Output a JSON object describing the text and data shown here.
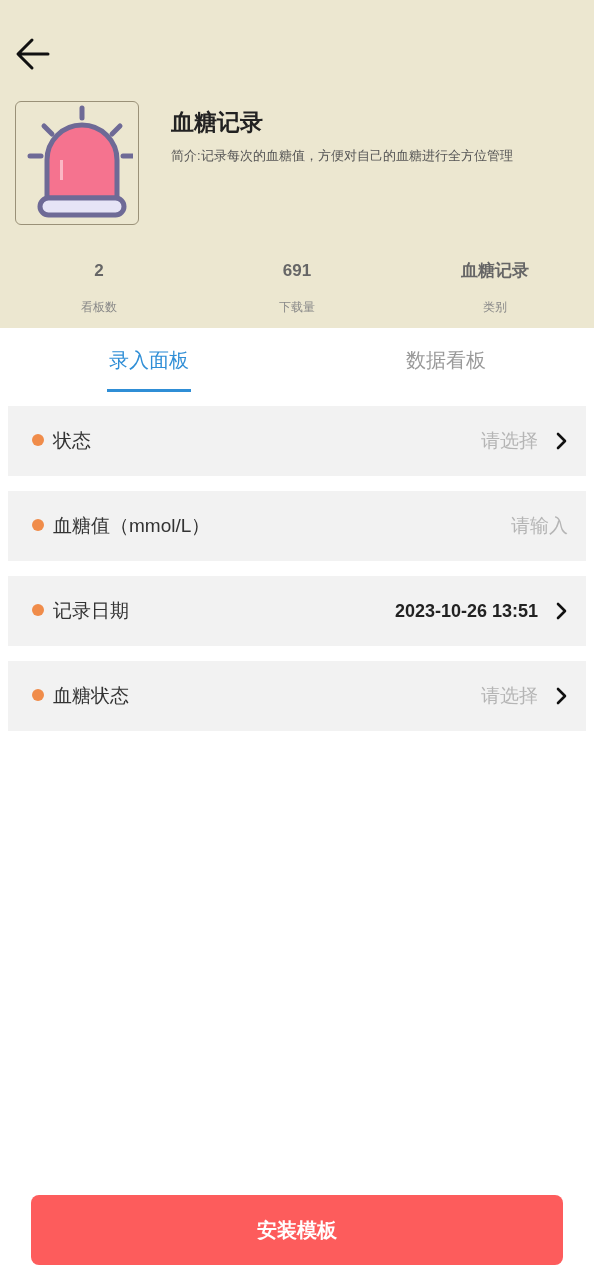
{
  "header": {
    "title": "血糖记录",
    "description": "简介:记录每次的血糖值，方便对自己的血糖进行全方位管理"
  },
  "stats": [
    {
      "value": "2",
      "label": "看板数"
    },
    {
      "value": "691",
      "label": "下载量"
    },
    {
      "value": "血糖记录",
      "label": "类别"
    }
  ],
  "tabs": [
    {
      "label": "录入面板",
      "selected": true
    },
    {
      "label": "数据看板",
      "selected": false
    }
  ],
  "fields": [
    {
      "kind": "select",
      "label": "状态",
      "required": true,
      "placeholder": "请选择"
    },
    {
      "kind": "input",
      "label": "血糖值（mmol/L）",
      "required": true,
      "placeholder": "请输入"
    },
    {
      "kind": "select",
      "label": "记录日期",
      "required": true,
      "value": "2023-10-26 13:51"
    },
    {
      "kind": "select",
      "label": "血糖状态",
      "required": true,
      "placeholder": "请选择"
    }
  ],
  "install_button": "安装模板"
}
